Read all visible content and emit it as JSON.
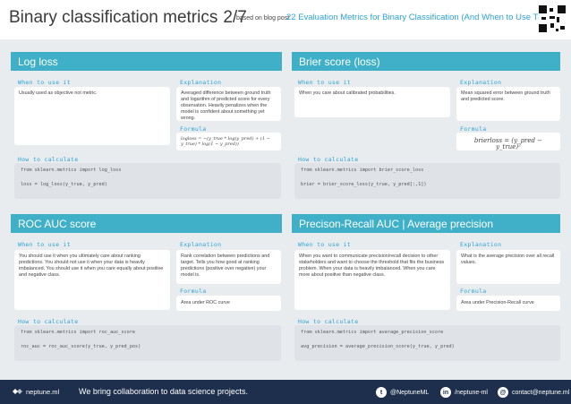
{
  "header": {
    "title": "Binary classification metrics",
    "page": "2/7",
    "based_on": "based on blog post",
    "blog_link": "22 Evaluation Metrics for Binary Classification (And When to Use Them)"
  },
  "labels": {
    "when": "When to use it",
    "explanation": "Explanation",
    "formula": "Formula",
    "how": "How to calculate"
  },
  "sections": {
    "logloss": {
      "title": "Log loss",
      "when": "Usually used as objective not metric.",
      "explanation": "Averaged difference between ground truth and logarithm of predicted score for every observation. Heavily penalizes when the model is confident about something yet wrong.",
      "formula": "logloss = −(y_true * log(y_pred) + (1 − y_true) * log(1 − y_pred))",
      "code_1": "from sklearn.metrics import log_loss",
      "code_2": "loss = log_loss(y_true, y_pred)"
    },
    "brier": {
      "title": "Brier score (loss)",
      "when": "When you care about calibrated probabilities.",
      "explanation": "Mean squared error between ground truth and predicted score.",
      "formula": "brierloss = (y_pred − y_true)²",
      "code_1": "from sklearn.metrics import brier_score_loss",
      "code_2": "brier = brier_score_loss(y_true, y_pred[:,1])"
    },
    "rocauc": {
      "title": "ROC AUC score",
      "when": "You should use it when you ultimately care about ranking predictions. You should not use it when your data is heavily imbalanced. You should use it when you care equally about positive and negative class.",
      "explanation": "Rank correlation between predictions and target. Tells you how good at ranking predictions (positive over negative) your model is.",
      "formula": "Area under ROC curve",
      "code_1": "from sklearn.metrics import roc_auc_score",
      "code_2": "roc_auc = roc_auc_score(y_true, y_pred_pos)"
    },
    "prauc": {
      "title": "Precison-Recall AUC | Average precision",
      "when": "When you want to communicate precision/recall decision to other stakeholders and want to choose the threshold that fits the business problem. When your data is heavily imbalanced. When you care more about positive than negative class.",
      "explanation": "What is the average precision over all recall values.",
      "formula": "Area under Precision-Recall curve",
      "code_1": "from sklearn.metrics import average_precision_score",
      "code_2": "avg_precision = average_precision_score(y_true, y_pred)"
    }
  },
  "footer": {
    "logo": "neptune.ml",
    "tagline": "We bring collaboration to data science projects.",
    "twitter": "@NeptuneML",
    "linkedin": "/neptune-ml",
    "email": "contact@neptune.ml"
  }
}
